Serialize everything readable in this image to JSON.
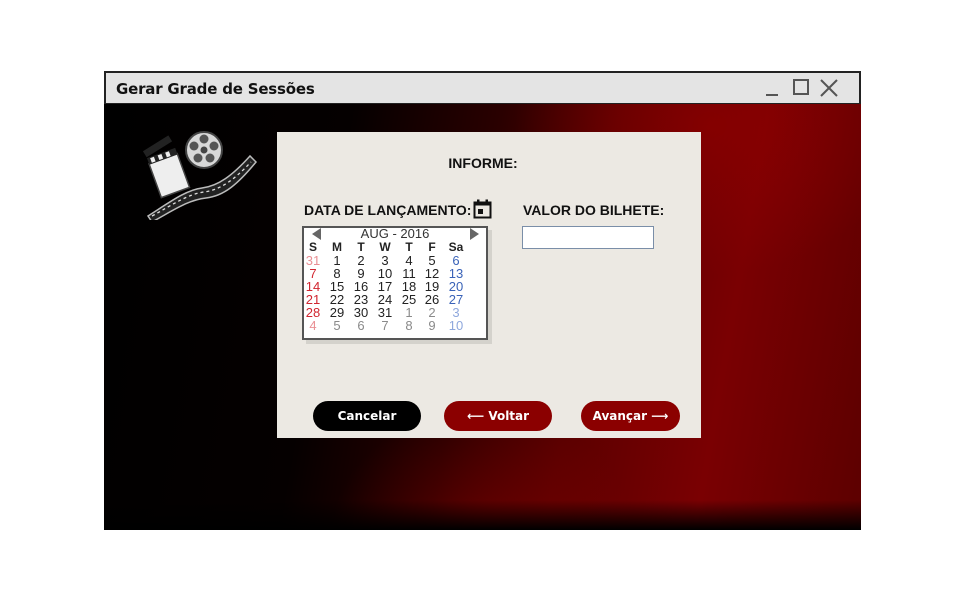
{
  "window": {
    "title": "Gerar Grade de Sessões"
  },
  "form": {
    "heading": "INFORME:",
    "release_date_label": "DATA DE LANÇAMENTO:",
    "ticket_value_label": "VALOR DO BILHETE:",
    "ticket_value": "",
    "ticket_value_placeholder": ""
  },
  "calendar": {
    "month_label": "AUG - 2016",
    "weekdays": [
      "S",
      "M",
      "T",
      "W",
      "T",
      "F",
      "Sa"
    ],
    "weeks": [
      [
        "31",
        "1",
        "2",
        "3",
        "4",
        "5",
        "6"
      ],
      [
        "7",
        "8",
        "9",
        "10",
        "11",
        "12",
        "13"
      ],
      [
        "14",
        "15",
        "16",
        "17",
        "18",
        "19",
        "20"
      ],
      [
        "21",
        "22",
        "23",
        "24",
        "25",
        "26",
        "27"
      ],
      [
        "28",
        "29",
        "30",
        "31",
        "1",
        "2",
        "3"
      ],
      [
        "4",
        "5",
        "6",
        "7",
        "8",
        "9",
        "10"
      ]
    ],
    "colors": {
      "sunday": "#d1252f",
      "saturday": "#3a63b8",
      "weekday": "#222222",
      "other_month_weekday": "#8a8a8a",
      "other_month_sunday": "#e98f94",
      "other_month_saturday": "#8fa8dd"
    }
  },
  "buttons": {
    "cancel": "Cancelar",
    "back": "⟵ Voltar",
    "next": "Avançar ⟶"
  },
  "icons": {
    "logo": "film-reel-clapperboard-icon",
    "calendar": "calendar-icon",
    "minimize": "minimize-icon",
    "maximize": "maximize-icon",
    "close": "close-icon"
  },
  "colors": {
    "accent": "#8b0000",
    "panel": "#ece9e3",
    "titlebar": "#e4e4e4"
  }
}
